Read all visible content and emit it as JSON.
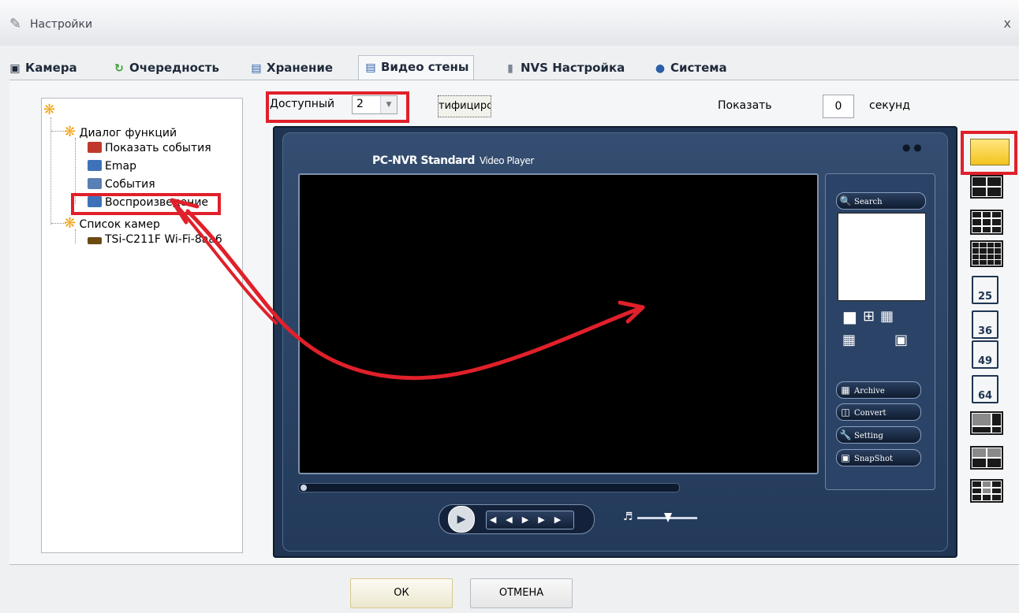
{
  "window": {
    "title": "Настройки",
    "close": "x"
  },
  "tabs": [
    {
      "label": "Камера",
      "icon": "camera-icon"
    },
    {
      "label": "Очередность",
      "icon": "refresh-icon"
    },
    {
      "label": "Хранение",
      "icon": "monitor-icon"
    },
    {
      "label": "Видео стены",
      "icon": "video-wall-icon",
      "active": true
    },
    {
      "label": "NVS Настройка",
      "icon": "server-icon"
    },
    {
      "label": "Система",
      "icon": "users-icon"
    }
  ],
  "tree": {
    "items": [
      {
        "label": "Диалог функций",
        "level": 1
      },
      {
        "label": "Показать события",
        "level": 2
      },
      {
        "label": "Emap",
        "level": 2
      },
      {
        "label": "События",
        "level": 2
      },
      {
        "label": "Воспроизведение",
        "level": 2
      },
      {
        "label": "Список камер",
        "level": 1
      },
      {
        "label": "TSi-C211F Wi-Fi-8aa6",
        "level": 2
      }
    ]
  },
  "toolbar": {
    "available_label": "Доступный",
    "available_value": "2",
    "identify_label": "тифицирс",
    "show_label": "Показать",
    "seconds_value": "0",
    "seconds_label": "секунд"
  },
  "player": {
    "title": "PC-NVR Standard",
    "subtitle": "Video Player",
    "buttons": {
      "search": "Search",
      "archive": "Archive",
      "convert": "Convert",
      "setting": "Setting",
      "snapshot": "SnapShot"
    }
  },
  "layouts": {
    "labels": [
      "25",
      "36",
      "49",
      "64"
    ]
  },
  "footer": {
    "ok": "ОК",
    "cancel": "ОТМЕНА"
  },
  "colors": {
    "highlight": "#e0202a",
    "player_bg": "#1f3552",
    "accent_yellow": "#f3c31c"
  }
}
